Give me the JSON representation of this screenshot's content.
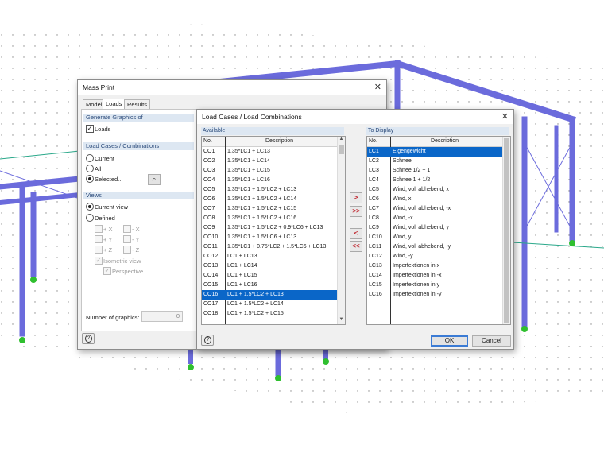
{
  "colors": {
    "steel": "#6b6bdc",
    "support": "#2fbf2f",
    "selection": "#0a66c8",
    "section_header": "#dde7f2"
  },
  "mass_print": {
    "title": "Mass Print",
    "tabs": [
      "Model",
      "Loads",
      "Results"
    ],
    "active_tab": "Loads",
    "generate_graphics": {
      "header": "Generate Graphics of",
      "loads_label": "Loads",
      "loads_checked": true
    },
    "load_cases": {
      "header": "Load Cases / Combinations",
      "options": [
        "Current",
        "All",
        "Selected..."
      ],
      "selected": "Selected..."
    },
    "views": {
      "header": "Views",
      "options": [
        "Current view",
        "Defined"
      ],
      "selected": "Current view",
      "directions": [
        "+ X",
        "- X",
        "+ Y",
        "- Y",
        "+ Z",
        "- Z"
      ],
      "isometric": "Isometric view",
      "perspective": "Perspective"
    },
    "number_of_graphics_label": "Number of graphics:",
    "number_of_graphics_value": "0"
  },
  "lc_dialog": {
    "title": "Load Cases / Load Combinations",
    "available_label": "Available",
    "to_display_label": "To Display",
    "col_no": "No.",
    "col_desc": "Description",
    "available": [
      {
        "no": "CO1",
        "desc": "1.35*LC1 + LC13"
      },
      {
        "no": "CO2",
        "desc": "1.35*LC1 + LC14"
      },
      {
        "no": "CO3",
        "desc": "1.35*LC1 + LC15"
      },
      {
        "no": "CO4",
        "desc": "1.35*LC1 + LC16"
      },
      {
        "no": "CO5",
        "desc": "1.35*LC1 + 1.5*LC2 + LC13"
      },
      {
        "no": "CO6",
        "desc": "1.35*LC1 + 1.5*LC2 + LC14"
      },
      {
        "no": "CO7",
        "desc": "1.35*LC1 + 1.5*LC2 + LC15"
      },
      {
        "no": "CO8",
        "desc": "1.35*LC1 + 1.5*LC2 + LC16"
      },
      {
        "no": "CO9",
        "desc": "1.35*LC1 + 1.5*LC2 + 0.9*LC6 + LC13"
      },
      {
        "no": "CO10",
        "desc": "1.35*LC1 + 1.5*LC6 + LC13"
      },
      {
        "no": "CO11",
        "desc": "1.35*LC1 + 0.75*LC2 + 1.5*LC6 + LC13"
      },
      {
        "no": "CO12",
        "desc": "LC1 + LC13"
      },
      {
        "no": "CO13",
        "desc": "LC1 + LC14"
      },
      {
        "no": "CO14",
        "desc": "LC1 + LC15"
      },
      {
        "no": "CO15",
        "desc": "LC1 + LC16"
      },
      {
        "no": "CO16",
        "desc": "LC1 + 1.5*LC2 + LC13"
      },
      {
        "no": "CO17",
        "desc": "LC1 + 1.5*LC2 + LC14"
      },
      {
        "no": "CO18",
        "desc": "LC1 + 1.5*LC2 + LC15"
      }
    ],
    "available_selected": "CO16",
    "to_display": [
      {
        "no": "LC1",
        "desc": "Eigengewicht"
      },
      {
        "no": "LC2",
        "desc": "Schnee"
      },
      {
        "no": "LC3",
        "desc": "Schnee 1/2 + 1"
      },
      {
        "no": "LC4",
        "desc": "Schnee 1 + 1/2"
      },
      {
        "no": "LC5",
        "desc": "Wind, voll abhebend, x"
      },
      {
        "no": "LC6",
        "desc": "Wind, x"
      },
      {
        "no": "LC7",
        "desc": "Wind, voll abhebend, -x"
      },
      {
        "no": "LC8",
        "desc": "Wind, -x"
      },
      {
        "no": "LC9",
        "desc": "Wind, voll abhebend, y"
      },
      {
        "no": "LC10",
        "desc": "Wind, y"
      },
      {
        "no": "LC11",
        "desc": "Wind, voll abhebend, -y"
      },
      {
        "no": "LC12",
        "desc": "Wind, -y"
      },
      {
        "no": "LC13",
        "desc": "Imperfektionen in x"
      },
      {
        "no": "LC14",
        "desc": "Imperfektionen in -x"
      },
      {
        "no": "LC15",
        "desc": "Imperfektionen in y"
      },
      {
        "no": "LC16",
        "desc": "Imperfektionen in -y"
      }
    ],
    "to_display_selected": "LC1",
    "move_buttons": [
      ">",
      ">>",
      "<",
      "<<"
    ],
    "ok_label": "OK",
    "cancel_label": "Cancel"
  }
}
